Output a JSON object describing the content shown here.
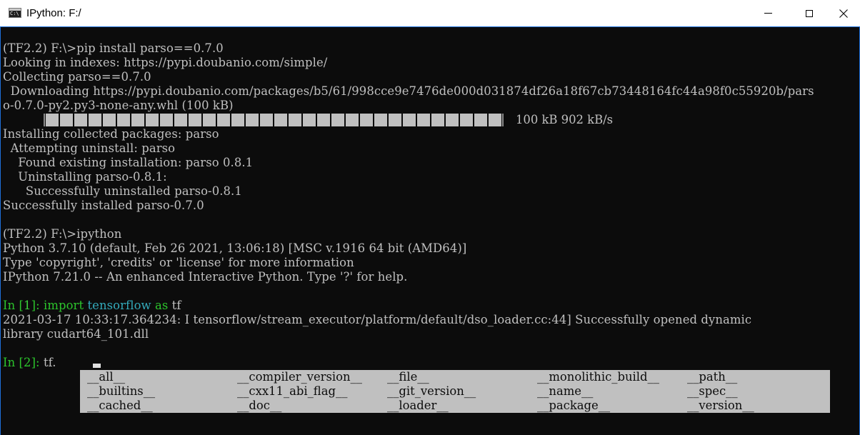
{
  "window": {
    "title": "IPython: F:/",
    "icon": "console-icon",
    "icon_text": "C:\\",
    "buttons": [
      "minimize",
      "maximize",
      "close"
    ]
  },
  "console": {
    "lines": [
      "(TF2.2) F:\\>pip install parso==0.7.0",
      "Looking in indexes: https://pypi.doubanio.com/simple/",
      "Collecting parso==0.7.0",
      "  Downloading https://pypi.doubanio.com/packages/b5/61/998cce9e7476de000d031874df26a18f67cb73448164fc44a98f0c55920b/pars",
      "o-0.7.0-py2.py3-none-any.whl (100 kB)",
      "Installing collected packages: parso",
      "  Attempting uninstall: parso",
      "    Found existing installation: parso 0.8.1",
      "    Uninstalling parso-0.8.1:",
      "      Successfully uninstalled parso-0.8.1",
      "Successfully installed parso-0.7.0",
      "(TF2.2) F:\\>ipython",
      "Python 3.7.10 (default, Feb 26 2021, 13:06:18) [MSC v.1916 64 bit (AMD64)]",
      "Type 'copyright', 'credits' or 'license' for more information",
      "IPython 7.21.0 -- An enhanced Interactive Python. Type '?' for help.",
      "2021-03-17 10:33:17.364234: I tensorflow/stream_executor/platform/default/dso_loader.cc:44] Successfully opened dynamic",
      "library cudart64_101.dll"
    ],
    "progress": {
      "fraction": 1.0,
      "text": "100 kB 902 kB/s"
    },
    "in1": {
      "prompt_in": "In [",
      "num": "1",
      "prompt_close": "]: ",
      "kw_import": "import",
      "module": "tensorflow",
      "kw_as": "as",
      "alias": "tf"
    },
    "in2": {
      "prompt": "In [2]: ",
      "code": "tf."
    }
  },
  "completion": {
    "items": [
      "__all__",
      "__compiler_version__",
      "__file__",
      "__monolithic_build__",
      "__path__",
      "__builtins__",
      "__cxx11_abi_flag__",
      "__git_version__",
      "__name__",
      "__spec__",
      "__cached__",
      "__doc__",
      "__loader__",
      "__package__",
      "__version__"
    ]
  },
  "colors": {
    "background": "#0c0c0c",
    "text": "#c0c0c0",
    "prompt": "#2cc52c",
    "keyword": "#2cc52c",
    "module": "#33aabb",
    "popup": "#c0c0c0"
  }
}
